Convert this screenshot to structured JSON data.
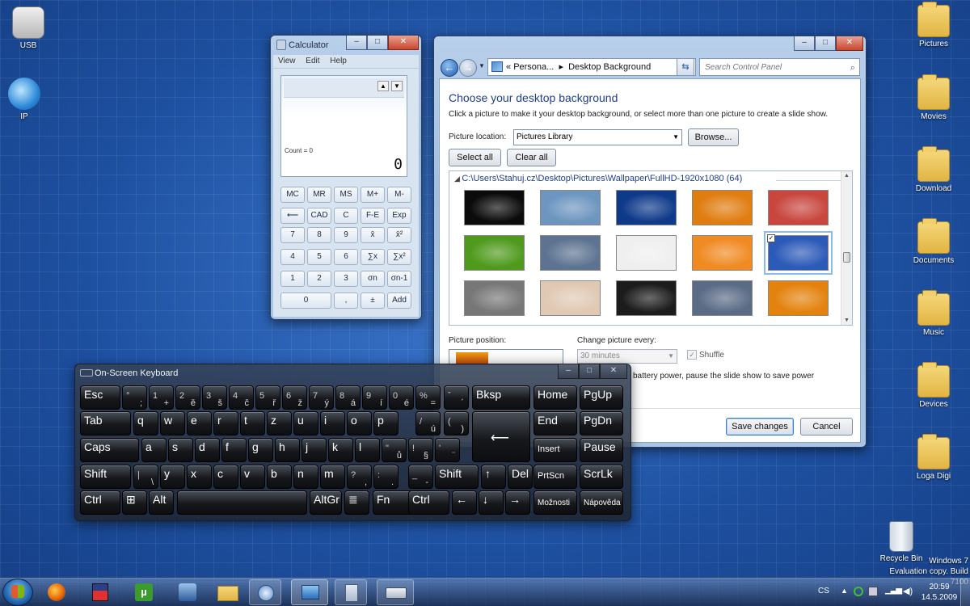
{
  "desktop": {
    "icons_left": [
      {
        "label": "USB"
      },
      {
        "label": "IP"
      }
    ],
    "icons_right": [
      {
        "label": "Pictures"
      },
      {
        "label": "Movies"
      },
      {
        "label": "Download"
      },
      {
        "label": "Documents"
      },
      {
        "label": "Music"
      },
      {
        "label": "Devices"
      },
      {
        "label": "Loga Digi"
      }
    ],
    "recycle_bin": "Recycle Bin",
    "watermark_line1": "Windows 7",
    "watermark_line2": "Evaluation copy. Build 7100"
  },
  "calculator": {
    "title": "Calculator",
    "menu": [
      "View",
      "Edit",
      "Help"
    ],
    "count": "Count = 0",
    "display": "0",
    "rows": [
      [
        "MC",
        "MR",
        "MS",
        "M+",
        "M-"
      ],
      [
        "⟵",
        "CAD",
        "C",
        "F-E",
        "Exp"
      ],
      [
        "7",
        "8",
        "9",
        "x̄",
        "x̄²"
      ],
      [
        "4",
        "5",
        "6",
        "∑x",
        "∑x²"
      ],
      [
        "1",
        "2",
        "3",
        "σn",
        "σn-1"
      ],
      [
        "0",
        ",",
        "±",
        "Add"
      ]
    ]
  },
  "control_panel": {
    "address_root": "Persona...",
    "address_page": "Desktop Background",
    "search_placeholder": "Search Control Panel",
    "heading": "Choose your desktop background",
    "subtitle": "Click a picture to make it your desktop background, or select more than one picture to create a slide show.",
    "picture_location_label": "Picture location:",
    "picture_location_value": "Pictures Library",
    "browse": "Browse...",
    "select_all": "Select all",
    "clear_all": "Clear all",
    "folder_path": "C:\\Users\\Stahuj.cz\\Desktop\\Pictures\\Wallpaper\\FullHD-1920x1080 (64)",
    "picture_position_label": "Picture position:",
    "change_every_label": "Change picture every:",
    "change_every_value": "30 minutes",
    "shuffle": "Shuffle",
    "battery_text": "battery power, pause the slide show to save power",
    "save": "Save changes",
    "cancel": "Cancel",
    "thumb_colors": [
      "#0b0b0b",
      "#6d95c0",
      "#0f3a8a",
      "#e07d10",
      "#c8463e",
      "#4f9a1d",
      "#5d7391",
      "#efefef",
      "#f08a22",
      "#2c5ab8",
      "#777777",
      "#e0c9b4",
      "#1c1c1c",
      "#5a6b86",
      "#e3820c"
    ]
  },
  "keyboard": {
    "title": "On-Screen Keyboard",
    "rows": [
      [
        [
          "Esc",
          ""
        ],
        [
          "°",
          ";"
        ],
        [
          "1",
          "+"
        ],
        [
          "2",
          "ě"
        ],
        [
          "3",
          "š"
        ],
        [
          "4",
          "č"
        ],
        [
          "5",
          "ř"
        ],
        [
          "6",
          "ž"
        ],
        [
          "7",
          "ý"
        ],
        [
          "8",
          "á"
        ],
        [
          "9",
          "í"
        ],
        [
          "0",
          "é"
        ],
        [
          "%",
          "="
        ],
        [
          "ˇ",
          "´"
        ],
        [
          "Bksp",
          ""
        ],
        [
          "Home",
          ""
        ],
        [
          "PgUp",
          ""
        ]
      ],
      [
        [
          "Tab",
          ""
        ],
        [
          "q",
          ""
        ],
        [
          "w",
          ""
        ],
        [
          "e",
          ""
        ],
        [
          "r",
          ""
        ],
        [
          "t",
          ""
        ],
        [
          "z",
          ""
        ],
        [
          "u",
          ""
        ],
        [
          "i",
          ""
        ],
        [
          "o",
          ""
        ],
        [
          "p",
          ""
        ],
        [
          "/",
          "ú"
        ],
        [
          "(",
          ")"
        ],
        [
          "Enter",
          ""
        ],
        [
          "End",
          ""
        ],
        [
          "PgDn",
          ""
        ]
      ],
      [
        [
          "Caps",
          ""
        ],
        [
          "a",
          ""
        ],
        [
          "s",
          ""
        ],
        [
          "d",
          ""
        ],
        [
          "f",
          ""
        ],
        [
          "g",
          ""
        ],
        [
          "h",
          ""
        ],
        [
          "j",
          ""
        ],
        [
          "k",
          ""
        ],
        [
          "l",
          ""
        ],
        [
          "\"",
          "ů"
        ],
        [
          "!",
          "§"
        ],
        [
          "'",
          "¨"
        ],
        [
          "Insert",
          ""
        ],
        [
          "Pause",
          ""
        ]
      ],
      [
        [
          "Shift",
          ""
        ],
        [
          "|",
          "\\"
        ],
        [
          "y",
          ""
        ],
        [
          "x",
          ""
        ],
        [
          "c",
          ""
        ],
        [
          "v",
          ""
        ],
        [
          "b",
          ""
        ],
        [
          "n",
          ""
        ],
        [
          "m",
          ""
        ],
        [
          "?",
          ","
        ],
        [
          ":",
          "."
        ],
        [
          "_",
          "-"
        ],
        [
          "Shift",
          ""
        ],
        [
          "↑",
          ""
        ],
        [
          "Del",
          ""
        ],
        [
          "PrtScn",
          ""
        ],
        [
          "ScrLk",
          ""
        ]
      ],
      [
        [
          "Ctrl",
          ""
        ],
        [
          "⊞",
          ""
        ],
        [
          "Alt",
          ""
        ],
        [
          "",
          ""
        ],
        [
          "AltGr",
          ""
        ],
        [
          "≣",
          ""
        ],
        [
          "Fn",
          ""
        ],
        [
          "Ctrl",
          ""
        ],
        [
          "←",
          ""
        ],
        [
          "↓",
          ""
        ],
        [
          "→",
          ""
        ],
        [
          "Možnosti",
          ""
        ],
        [
          "Nápověda",
          ""
        ]
      ]
    ]
  },
  "taskbar": {
    "language": "CS",
    "time": "20:59",
    "date": "14.5.2009"
  }
}
